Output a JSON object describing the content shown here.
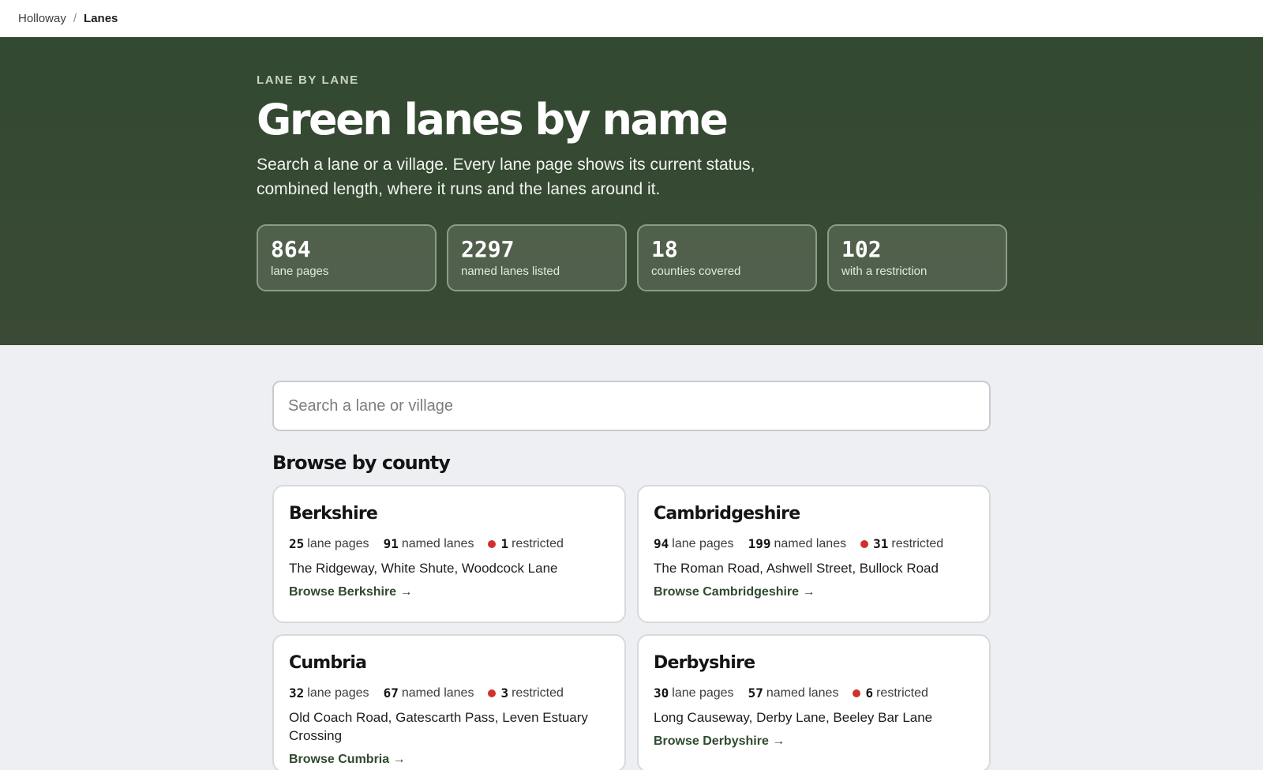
{
  "breadcrumb": {
    "home": "Holloway",
    "separator": "/",
    "current": "Lanes"
  },
  "hero": {
    "kicker": "LANE BY LANE",
    "title": "Green lanes by name",
    "description": "Search a lane or a village. Every lane page shows its current status, combined length, where it runs and the lanes around it.",
    "stats": [
      {
        "value": "864",
        "label": "lane pages"
      },
      {
        "value": "2297",
        "label": "named lanes listed"
      },
      {
        "value": "18",
        "label": "counties covered"
      },
      {
        "value": "102",
        "label": "with a restriction"
      }
    ]
  },
  "search": {
    "placeholder": "Search a lane or village",
    "value": ""
  },
  "browse": {
    "title": "Browse by county",
    "lane_pages_label": "lane pages",
    "named_lanes_label": "named lanes",
    "restricted_label": "restricted",
    "restricted_color": "#d0312d",
    "counties": [
      {
        "name": "Berkshire",
        "lane_pages": "25",
        "named_lanes": "91",
        "restricted": "1",
        "lanes": "The Ridgeway, White Shute, Woodcock Lane",
        "link": "Browse Berkshire →"
      },
      {
        "name": "Cambridgeshire",
        "lane_pages": "94",
        "named_lanes": "199",
        "restricted": "31",
        "lanes": "The Roman Road, Ashwell Street, Bullock Road",
        "link": "Browse Cambridgeshire →"
      },
      {
        "name": "Cumbria",
        "lane_pages": "32",
        "named_lanes": "67",
        "restricted": "3",
        "lanes": "Old Coach Road, Gatescarth Pass, Leven Estuary Crossing",
        "link": "Browse Cumbria →"
      },
      {
        "name": "Derbyshire",
        "lane_pages": "30",
        "named_lanes": "57",
        "restricted": "6",
        "lanes": "Long Causeway, Derby Lane, Beeley Bar Lane",
        "link": "Browse Derbyshire →"
      }
    ]
  }
}
